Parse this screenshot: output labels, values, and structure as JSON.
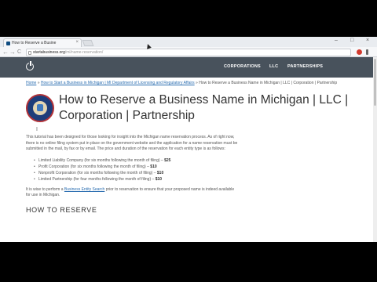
{
  "browser": {
    "tab_title": "How to Reserve a Busine",
    "tab_close": "×",
    "url_domain": "startabusiness.org",
    "url_path": "/mi/name-reservation/",
    "back": "←",
    "forward": "→",
    "reload": "C",
    "minimize": "–",
    "maximize": "□",
    "close": "×"
  },
  "site": {
    "nav": [
      "CORPORATIONS",
      "LLC",
      "PARTNERSHIPS"
    ]
  },
  "breadcrumb": {
    "home": "Home",
    "sep": " » ",
    "parent": "How to Start a Business in Michigan | MI Department of Licensing and Regulatory Affairs",
    "current": "How to Reserve a Business Name in Michigan | LLC | Corporation | Partnership"
  },
  "page": {
    "title": "How to Reserve a Business Name in Michigan | LLC | Corporation | Partnership",
    "intro": "This tutorial has been designed for those looking for insight into the Michigan name reservation process. As of right now, there is no online filing system put in place on the government website and the application for a name reservation must be submitted in the mail, by fax or by email. The price and duration of the reservation for each entity type is as follows:",
    "fees": [
      {
        "text": "Limited Liability Company (for six months following the month of filing) – ",
        "price": "$25"
      },
      {
        "text": "Profit Corporation (for six months following the month of filing) – ",
        "price": "$10"
      },
      {
        "text": "Nonprofit Corporation (for six months following the month of filing) – ",
        "price": "$10"
      },
      {
        "text": "Limited Partnership (for four months following the month of filing) – ",
        "price": "$10"
      }
    ],
    "advice_pre": "It is wise to perform a ",
    "advice_link": "Business Entity Search",
    "advice_post": " prior to reservation to ensure that your proposed name is indeed available for use in Michigan.",
    "section_heading": "HOW TO RESERVE"
  }
}
